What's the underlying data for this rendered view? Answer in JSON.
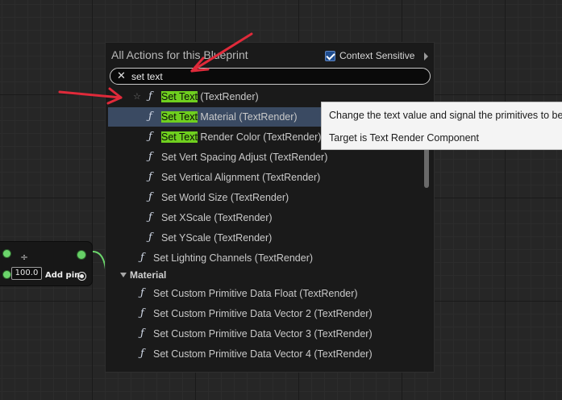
{
  "node": {
    "value": "100.0",
    "add_pin_label": "Add pin"
  },
  "popup": {
    "title": "All Actions for this Blueprint",
    "context_sensitive_label": "Context Sensitive",
    "context_sensitive_checked": true,
    "search_value": "set text",
    "search_highlight": "Set Text",
    "items": [
      {
        "prefix": "Set Text",
        "rest": " (TextRender)",
        "starred": true
      },
      {
        "prefix": "Set Text",
        "rest": " Material (TextRender)",
        "selected": true
      },
      {
        "prefix": "Set Text",
        "rest": " Render Color (TextRender)"
      },
      {
        "prefix": "",
        "rest": "Set Vert Spacing Adjust (TextRender)"
      },
      {
        "prefix": "",
        "rest": "Set Vertical Alignment (TextRender)"
      },
      {
        "prefix": "",
        "rest": "Set World Size (TextRender)"
      },
      {
        "prefix": "",
        "rest": "Set XScale (TextRender)"
      },
      {
        "prefix": "",
        "rest": "Set YScale (TextRender)"
      }
    ],
    "lighting_item": "Set Lighting Channels (TextRender)",
    "category": "Material",
    "material_items": [
      "Set Custom Primitive Data Float (TextRender)",
      "Set Custom Primitive Data Vector 2 (TextRender)",
      "Set Custom Primitive Data Vector 3 (TextRender)",
      "Set Custom Primitive Data Vector 4 (TextRender)"
    ]
  },
  "tooltip": {
    "line1": "Change the text value and signal the primitives to be re",
    "line2": "Target is Text Render Component"
  },
  "colors": {
    "highlight": "#6fcf1f",
    "selection": "#3a4a62",
    "annotation_arrow": "#e02a3a",
    "pin_green": "#6bd66b"
  },
  "icons": {
    "function": "function-icon",
    "clear": "close-icon",
    "star": "star-icon"
  }
}
